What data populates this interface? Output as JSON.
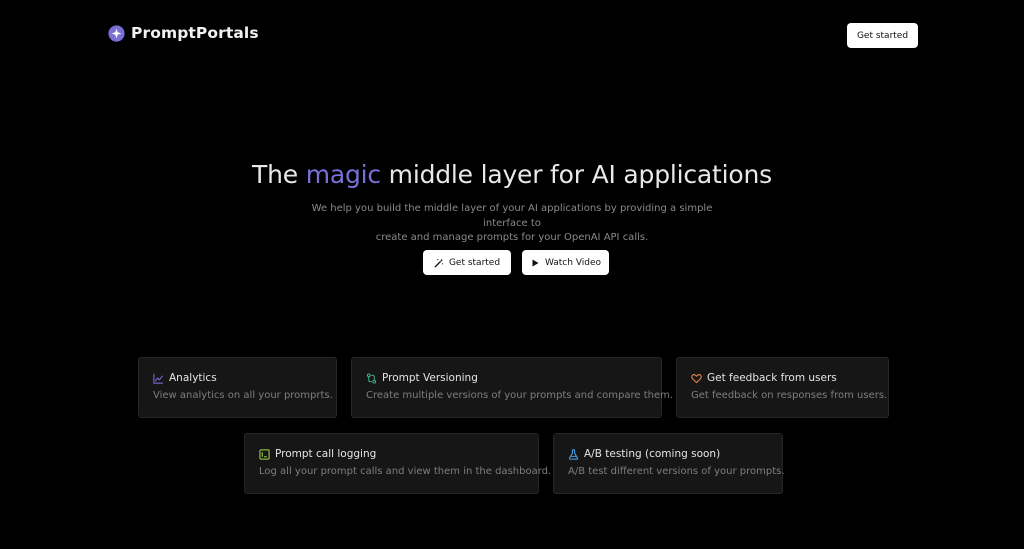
{
  "nav": {
    "brand_name": "PromptPortals",
    "cta_label": "Get started"
  },
  "hero": {
    "title_before": "The ",
    "title_highlight": "magic",
    "title_after": " middle layer for AI applications",
    "subtitle_line1": "We help you build the middle layer of your AI applications by providing a simple interface to",
    "subtitle_line2": "create and manage prompts for your OpenAI API calls.",
    "primary_label": "Get started",
    "secondary_label": "Watch Video"
  },
  "features": [
    {
      "title": "Analytics",
      "desc": "View analytics on all your promprts.",
      "icon": "chart-icon"
    },
    {
      "title": "Prompt Versioning",
      "desc": "Create multiple versions of your prompts and compare them.",
      "icon": "git-compare-icon"
    },
    {
      "title": "Get feedback from users",
      "desc": "Get feedback on responses from users.",
      "icon": "heart-icon"
    },
    {
      "title": "Prompt call logging",
      "desc": "Log all your prompt calls and view them in the dashboard.",
      "icon": "log-icon"
    },
    {
      "title": "A/B testing (coming soon)",
      "desc": "A/B test different versions of your prompts.",
      "icon": "flask-icon"
    }
  ],
  "colors": {
    "background": "#000000",
    "accent": "#7a6fd6",
    "card_bg": "#161616",
    "chart_icon": "#7d74e0",
    "versioning_icon": "#3fbf8a",
    "heart_icon": "#ef8a4a",
    "log_icon": "#a3d94a",
    "flask_icon": "#4aa8ef"
  }
}
